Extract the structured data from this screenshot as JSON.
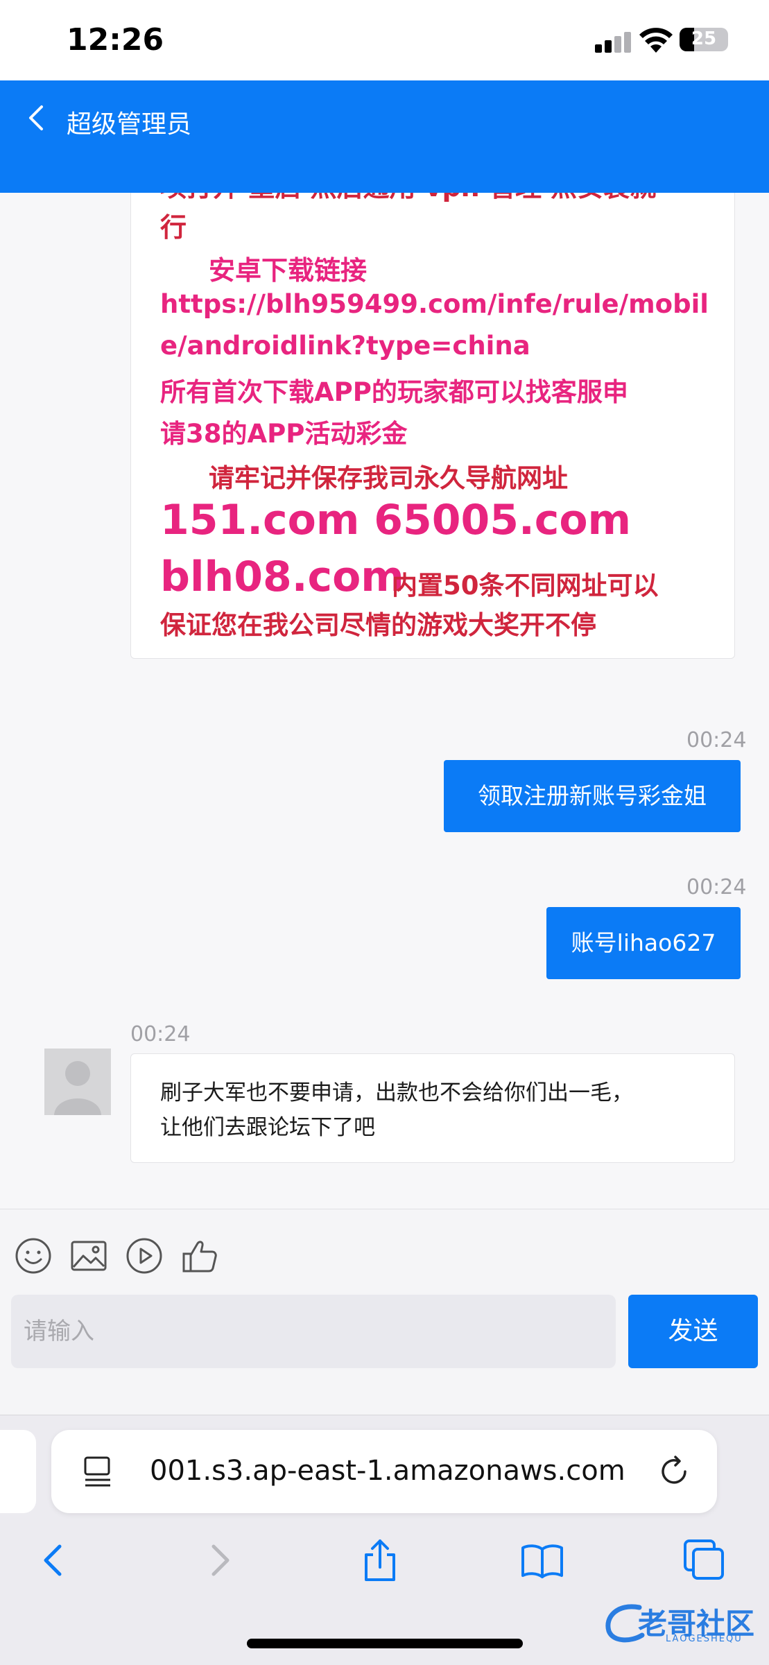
{
  "status_bar": {
    "time": "12:26",
    "battery": "25"
  },
  "header": {
    "title": "超级管理员"
  },
  "promo": {
    "lines": [
      "项打开 重启 然后通用 vpn 管理 点安装就",
      "行",
      "安卓下载链接",
      "https://blh959499.com/infe/rule/mobil",
      "e/androidlink?type=china",
      "所有首次下载APP的玩家都可以找客服申",
      "请38的APP活动彩金",
      "请牢记并保存我司永久导航网址",
      "151.com 65005.com",
      "blh08.com",
      "内置50条不同网址可以",
      "保证您在我公司尽情的游戏大奖开不停"
    ]
  },
  "messages": [
    {
      "time": "00:24",
      "text": "领取注册新账号彩金姐"
    },
    {
      "time": "00:24",
      "text": "账号lihao627"
    },
    {
      "time": "00:24",
      "lines": [
        "刷子大军也不要申请，出款也不会给你们出一毛，",
        "让他们去跟论坛下了吧"
      ]
    }
  ],
  "composer": {
    "placeholder": "请输入",
    "send_label": "发送"
  },
  "browser": {
    "url": "001.s3.ap-east-1.amazonaws.com"
  },
  "watermark": {
    "text": "老哥社区",
    "sub": "LAOGESHEQU"
  },
  "colors": {
    "primary": "#0b7bf6",
    "promo_pink": "#e8247f",
    "promo_red": "#d0253d"
  }
}
